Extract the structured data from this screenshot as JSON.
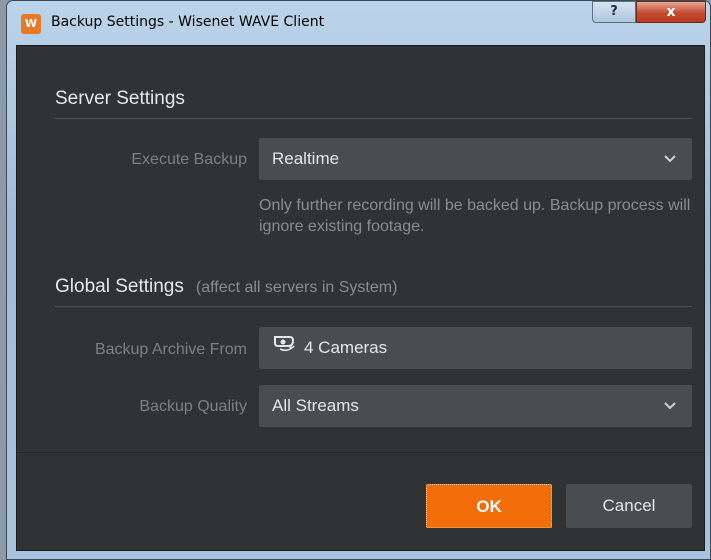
{
  "window": {
    "app_icon": "W",
    "title": "Backup Settings - Wisenet WAVE Client",
    "help_label": "?",
    "close_label": "x"
  },
  "server_settings": {
    "title": "Server Settings",
    "execute_backup_label": "Execute Backup",
    "execute_backup_value": "Realtime",
    "hint": "Only further recording will be backed up. Backup process will ignore existing footage."
  },
  "global_settings": {
    "title": "Global Settings",
    "subtitle": "(affect all servers in System)",
    "archive_from_label": "Backup Archive From",
    "archive_from_value": "4 Cameras",
    "quality_label": "Backup Quality",
    "quality_value": "All Streams"
  },
  "buttons": {
    "ok": "OK",
    "cancel": "Cancel"
  },
  "icons": {
    "dropdown": "chevron-down-icon",
    "cameras": "camera-icon"
  },
  "colors": {
    "accent": "#f46d0b",
    "panel_bg": "#303234",
    "field_bg": "#4a4d50"
  }
}
